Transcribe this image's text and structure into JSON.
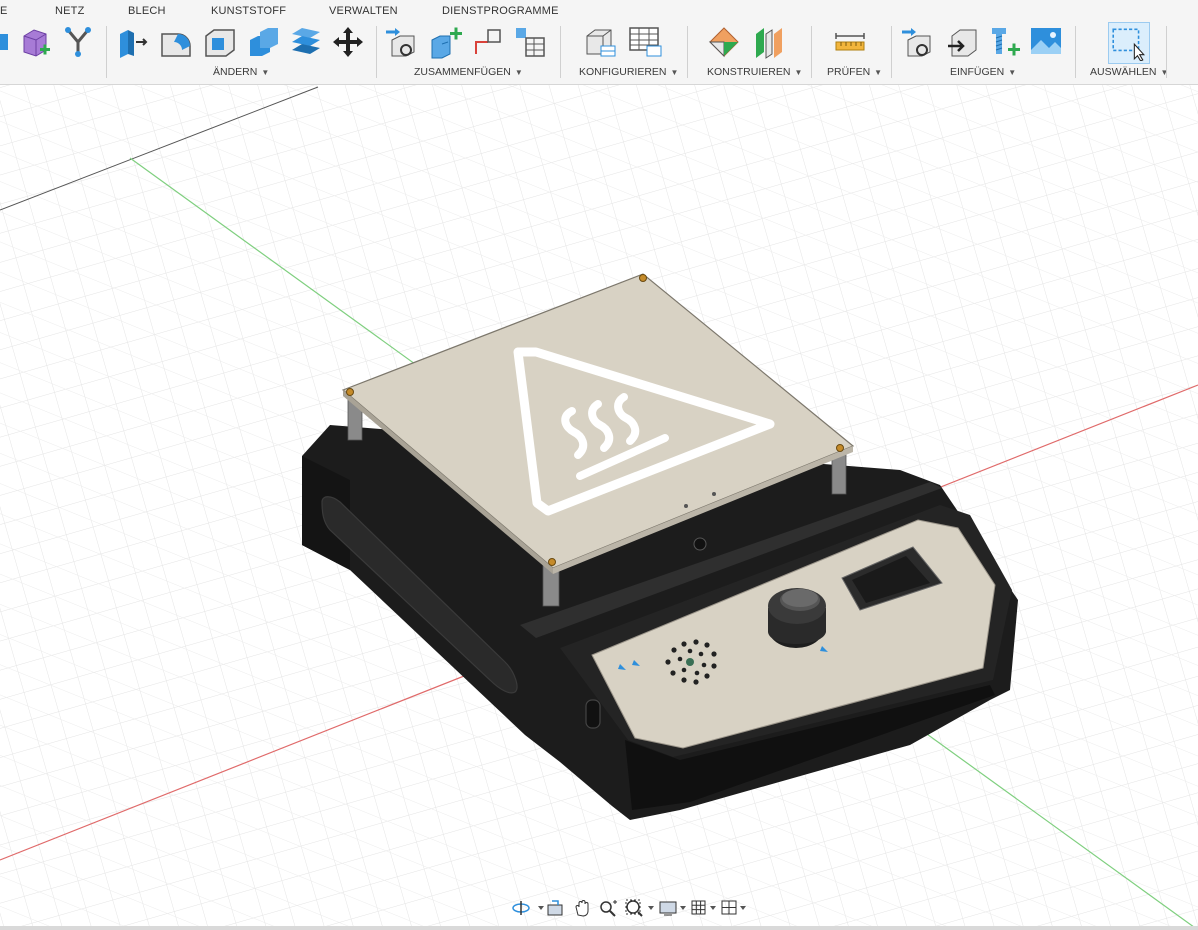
{
  "toolbar": {
    "tabs": [
      "NETZ",
      "BLECH",
      "KUNSTSTOFF",
      "VERWALTEN",
      "DIENSTPROGRAMME"
    ],
    "groups": {
      "modify": "ÄNDERN",
      "assemble": "ZUSAMMENFÜGEN",
      "configure": "KONFIGURIEREN",
      "construct": "KONSTRUIEREN",
      "inspect": "PRÜFEN",
      "insert": "EINFÜGEN",
      "select": "AUSWÄHLEN"
    },
    "caret": "▼",
    "left_cut_label": "E"
  },
  "accent_colors": {
    "toolbar_blue": "#2e8fdc",
    "add_green": "#2ea94f",
    "grid_red_axis": "#e06a6a",
    "grid_green_axis": "#7fcf7f",
    "plate": "#d8d2c4",
    "body": "#1c1c1c"
  },
  "icons": [
    "extrude-icon",
    "fillet-icon",
    "shell-icon",
    "combine-icon",
    "press-pull-icon",
    "move-icon",
    "joint-icon",
    "new-component-icon",
    "as-built-joint-icon",
    "configure-table-icon",
    "plane-icon",
    "midplane-icon",
    "measure-icon",
    "insert-derive-icon",
    "decal-icon",
    "insert-mcmaster-icon",
    "canvas-icon",
    "select-icon",
    "orbit-icon",
    "look-at-icon",
    "pan-icon",
    "zoom-icon",
    "fit-icon",
    "display-settings-icon",
    "grid-settings-icon",
    "viewports-icon"
  ]
}
